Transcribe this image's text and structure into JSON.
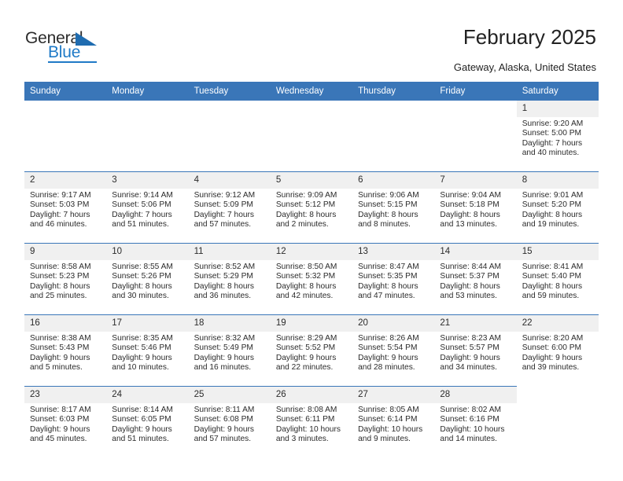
{
  "brand": {
    "name_part1": "General",
    "name_part2": "Blue",
    "accent_color": "#1f7ac7",
    "triangle_icon": "triangle-icon"
  },
  "header": {
    "title": "February 2025",
    "location": "Gateway, Alaska, United States",
    "header_bg_color": "#3a76b8"
  },
  "weekday_headers": [
    "Sunday",
    "Monday",
    "Tuesday",
    "Wednesday",
    "Thursday",
    "Friday",
    "Saturday"
  ],
  "weeks": [
    [
      {
        "empty": true
      },
      {
        "empty": true
      },
      {
        "empty": true
      },
      {
        "empty": true
      },
      {
        "empty": true
      },
      {
        "empty": true
      },
      {
        "day": "1",
        "sunrise": "Sunrise: 9:20 AM",
        "sunset": "Sunset: 5:00 PM",
        "daylight1": "Daylight: 7 hours",
        "daylight2": "and 40 minutes."
      }
    ],
    [
      {
        "day": "2",
        "sunrise": "Sunrise: 9:17 AM",
        "sunset": "Sunset: 5:03 PM",
        "daylight1": "Daylight: 7 hours",
        "daylight2": "and 46 minutes."
      },
      {
        "day": "3",
        "sunrise": "Sunrise: 9:14 AM",
        "sunset": "Sunset: 5:06 PM",
        "daylight1": "Daylight: 7 hours",
        "daylight2": "and 51 minutes."
      },
      {
        "day": "4",
        "sunrise": "Sunrise: 9:12 AM",
        "sunset": "Sunset: 5:09 PM",
        "daylight1": "Daylight: 7 hours",
        "daylight2": "and 57 minutes."
      },
      {
        "day": "5",
        "sunrise": "Sunrise: 9:09 AM",
        "sunset": "Sunset: 5:12 PM",
        "daylight1": "Daylight: 8 hours",
        "daylight2": "and 2 minutes."
      },
      {
        "day": "6",
        "sunrise": "Sunrise: 9:06 AM",
        "sunset": "Sunset: 5:15 PM",
        "daylight1": "Daylight: 8 hours",
        "daylight2": "and 8 minutes."
      },
      {
        "day": "7",
        "sunrise": "Sunrise: 9:04 AM",
        "sunset": "Sunset: 5:18 PM",
        "daylight1": "Daylight: 8 hours",
        "daylight2": "and 13 minutes."
      },
      {
        "day": "8",
        "sunrise": "Sunrise: 9:01 AM",
        "sunset": "Sunset: 5:20 PM",
        "daylight1": "Daylight: 8 hours",
        "daylight2": "and 19 minutes."
      }
    ],
    [
      {
        "day": "9",
        "sunrise": "Sunrise: 8:58 AM",
        "sunset": "Sunset: 5:23 PM",
        "daylight1": "Daylight: 8 hours",
        "daylight2": "and 25 minutes."
      },
      {
        "day": "10",
        "sunrise": "Sunrise: 8:55 AM",
        "sunset": "Sunset: 5:26 PM",
        "daylight1": "Daylight: 8 hours",
        "daylight2": "and 30 minutes."
      },
      {
        "day": "11",
        "sunrise": "Sunrise: 8:52 AM",
        "sunset": "Sunset: 5:29 PM",
        "daylight1": "Daylight: 8 hours",
        "daylight2": "and 36 minutes."
      },
      {
        "day": "12",
        "sunrise": "Sunrise: 8:50 AM",
        "sunset": "Sunset: 5:32 PM",
        "daylight1": "Daylight: 8 hours",
        "daylight2": "and 42 minutes."
      },
      {
        "day": "13",
        "sunrise": "Sunrise: 8:47 AM",
        "sunset": "Sunset: 5:35 PM",
        "daylight1": "Daylight: 8 hours",
        "daylight2": "and 47 minutes."
      },
      {
        "day": "14",
        "sunrise": "Sunrise: 8:44 AM",
        "sunset": "Sunset: 5:37 PM",
        "daylight1": "Daylight: 8 hours",
        "daylight2": "and 53 minutes."
      },
      {
        "day": "15",
        "sunrise": "Sunrise: 8:41 AM",
        "sunset": "Sunset: 5:40 PM",
        "daylight1": "Daylight: 8 hours",
        "daylight2": "and 59 minutes."
      }
    ],
    [
      {
        "day": "16",
        "sunrise": "Sunrise: 8:38 AM",
        "sunset": "Sunset: 5:43 PM",
        "daylight1": "Daylight: 9 hours",
        "daylight2": "and 5 minutes."
      },
      {
        "day": "17",
        "sunrise": "Sunrise: 8:35 AM",
        "sunset": "Sunset: 5:46 PM",
        "daylight1": "Daylight: 9 hours",
        "daylight2": "and 10 minutes."
      },
      {
        "day": "18",
        "sunrise": "Sunrise: 8:32 AM",
        "sunset": "Sunset: 5:49 PM",
        "daylight1": "Daylight: 9 hours",
        "daylight2": "and 16 minutes."
      },
      {
        "day": "19",
        "sunrise": "Sunrise: 8:29 AM",
        "sunset": "Sunset: 5:52 PM",
        "daylight1": "Daylight: 9 hours",
        "daylight2": "and 22 minutes."
      },
      {
        "day": "20",
        "sunrise": "Sunrise: 8:26 AM",
        "sunset": "Sunset: 5:54 PM",
        "daylight1": "Daylight: 9 hours",
        "daylight2": "and 28 minutes."
      },
      {
        "day": "21",
        "sunrise": "Sunrise: 8:23 AM",
        "sunset": "Sunset: 5:57 PM",
        "daylight1": "Daylight: 9 hours",
        "daylight2": "and 34 minutes."
      },
      {
        "day": "22",
        "sunrise": "Sunrise: 8:20 AM",
        "sunset": "Sunset: 6:00 PM",
        "daylight1": "Daylight: 9 hours",
        "daylight2": "and 39 minutes."
      }
    ],
    [
      {
        "day": "23",
        "sunrise": "Sunrise: 8:17 AM",
        "sunset": "Sunset: 6:03 PM",
        "daylight1": "Daylight: 9 hours",
        "daylight2": "and 45 minutes."
      },
      {
        "day": "24",
        "sunrise": "Sunrise: 8:14 AM",
        "sunset": "Sunset: 6:05 PM",
        "daylight1": "Daylight: 9 hours",
        "daylight2": "and 51 minutes."
      },
      {
        "day": "25",
        "sunrise": "Sunrise: 8:11 AM",
        "sunset": "Sunset: 6:08 PM",
        "daylight1": "Daylight: 9 hours",
        "daylight2": "and 57 minutes."
      },
      {
        "day": "26",
        "sunrise": "Sunrise: 8:08 AM",
        "sunset": "Sunset: 6:11 PM",
        "daylight1": "Daylight: 10 hours",
        "daylight2": "and 3 minutes."
      },
      {
        "day": "27",
        "sunrise": "Sunrise: 8:05 AM",
        "sunset": "Sunset: 6:14 PM",
        "daylight1": "Daylight: 10 hours",
        "daylight2": "and 9 minutes."
      },
      {
        "day": "28",
        "sunrise": "Sunrise: 8:02 AM",
        "sunset": "Sunset: 6:16 PM",
        "daylight1": "Daylight: 10 hours",
        "daylight2": "and 14 minutes."
      },
      {
        "empty": true
      }
    ]
  ]
}
